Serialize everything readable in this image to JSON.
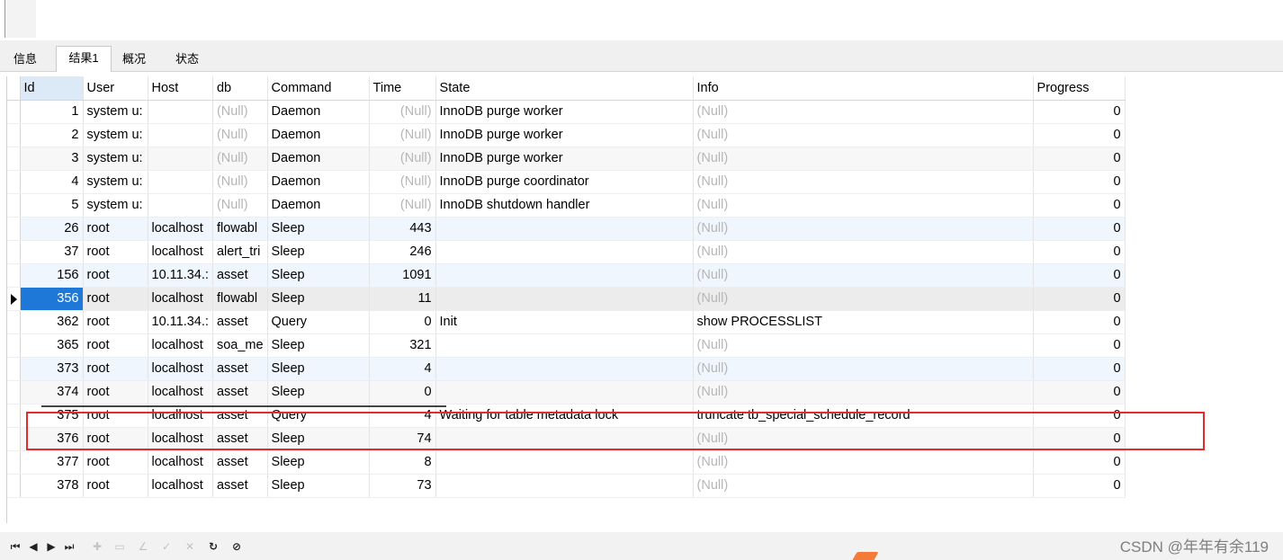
{
  "tabs": [
    {
      "label": "信息",
      "active": false
    },
    {
      "label": "结果1",
      "active": true
    },
    {
      "label": "概况",
      "active": false
    },
    {
      "label": "状态",
      "active": false
    }
  ],
  "columns": [
    "Id",
    "User",
    "Host",
    "db",
    "Command",
    "Time",
    "State",
    "Info",
    "Progress"
  ],
  "rows": [
    {
      "id": "1",
      "user": "system u:",
      "host": "",
      "db": "(Null)",
      "command": "Daemon",
      "time": "(Null)",
      "state": "InnoDB purge worker",
      "info": "(Null)",
      "progress": "0"
    },
    {
      "id": "2",
      "user": "system u:",
      "host": "",
      "db": "(Null)",
      "command": "Daemon",
      "time": "(Null)",
      "state": "InnoDB purge worker",
      "info": "(Null)",
      "progress": "0"
    },
    {
      "id": "3",
      "user": "system u:",
      "host": "",
      "db": "(Null)",
      "command": "Daemon",
      "time": "(Null)",
      "state": "InnoDB purge worker",
      "info": "(Null)",
      "progress": "0"
    },
    {
      "id": "4",
      "user": "system u:",
      "host": "",
      "db": "(Null)",
      "command": "Daemon",
      "time": "(Null)",
      "state": "InnoDB purge coordinator",
      "info": "(Null)",
      "progress": "0"
    },
    {
      "id": "5",
      "user": "system u:",
      "host": "",
      "db": "(Null)",
      "command": "Daemon",
      "time": "(Null)",
      "state": "InnoDB shutdown handler",
      "info": "(Null)",
      "progress": "0"
    },
    {
      "id": "26",
      "user": "root",
      "host": "localhost",
      "db": "flowabl",
      "command": "Sleep",
      "time": "443",
      "state": "",
      "info": "(Null)",
      "progress": "0"
    },
    {
      "id": "37",
      "user": "root",
      "host": "localhost",
      "db": "alert_tri",
      "command": "Sleep",
      "time": "246",
      "state": "",
      "info": "(Null)",
      "progress": "0"
    },
    {
      "id": "156",
      "user": "root",
      "host": "10.11.34.:",
      "db": "asset",
      "command": "Sleep",
      "time": "1091",
      "state": "",
      "info": "(Null)",
      "progress": "0"
    },
    {
      "id": "356",
      "user": "root",
      "host": "localhost",
      "db": "flowabl",
      "command": "Sleep",
      "time": "11",
      "state": "",
      "info": "(Null)",
      "progress": "0"
    },
    {
      "id": "362",
      "user": "root",
      "host": "10.11.34.:",
      "db": "asset",
      "command": "Query",
      "time": "0",
      "state": "Init",
      "info": "show PROCESSLIST",
      "progress": "0"
    },
    {
      "id": "365",
      "user": "root",
      "host": "localhost",
      "db": "soa_me",
      "command": "Sleep",
      "time": "321",
      "state": "",
      "info": "(Null)",
      "progress": "0"
    },
    {
      "id": "373",
      "user": "root",
      "host": "localhost",
      "db": "asset",
      "command": "Sleep",
      "time": "4",
      "state": "",
      "info": "(Null)",
      "progress": "0"
    },
    {
      "id": "374",
      "user": "root",
      "host": "localhost",
      "db": "asset",
      "command": "Sleep",
      "time": "0",
      "state": "",
      "info": "(Null)",
      "progress": "0"
    },
    {
      "id": "375",
      "user": "root",
      "host": "localhost",
      "db": "asset",
      "command": "Query",
      "time": "4",
      "state": "Waiting for table metadata lock",
      "info": "truncate tb_special_schedule_record",
      "progress": "0"
    },
    {
      "id": "376",
      "user": "root",
      "host": "localhost",
      "db": "asset",
      "command": "Sleep",
      "time": "74",
      "state": "",
      "info": "(Null)",
      "progress": "0"
    },
    {
      "id": "377",
      "user": "root",
      "host": "localhost",
      "db": "asset",
      "command": "Sleep",
      "time": "8",
      "state": "",
      "info": "(Null)",
      "progress": "0"
    },
    {
      "id": "378",
      "user": "root",
      "host": "localhost",
      "db": "asset",
      "command": "Sleep",
      "time": "73",
      "state": "",
      "info": "(Null)",
      "progress": "0"
    }
  ],
  "toolbar": {
    "icons": [
      "first-record-icon",
      "prev-record-icon",
      "next-record-icon",
      "last-record-icon",
      "add-record-icon",
      "delete-record-icon",
      "edit-record-icon",
      "apply-changes-icon",
      "discard-changes-icon",
      "refresh-icon",
      "stop-icon"
    ]
  },
  "watermark": "CSDN @年年有余119"
}
